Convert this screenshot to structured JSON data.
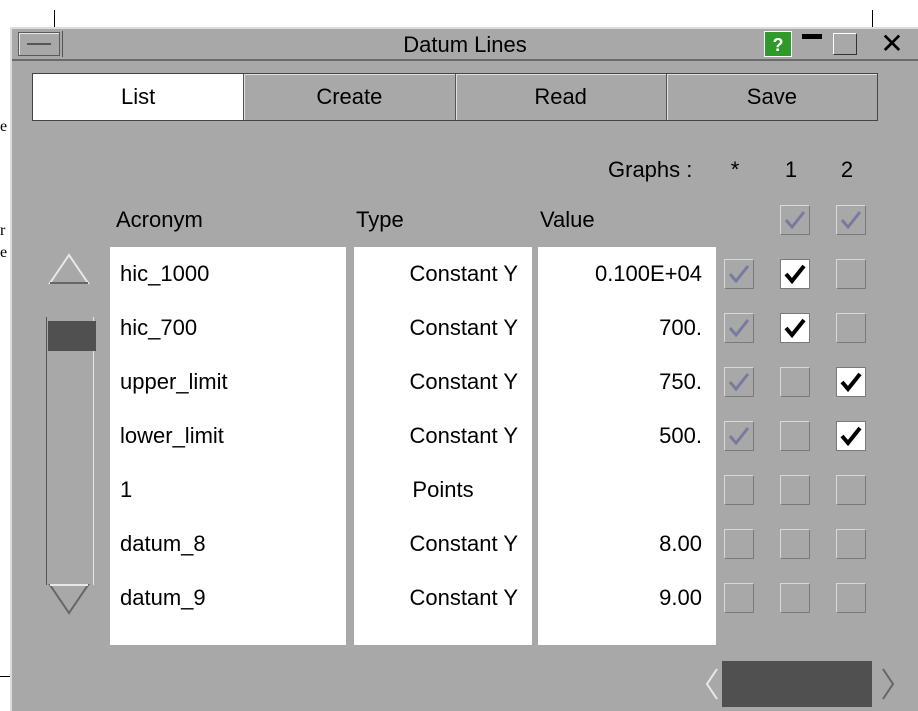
{
  "window": {
    "title": "Datum Lines",
    "help_label": "?",
    "close_label": "✕"
  },
  "tabs": [
    {
      "label": "List",
      "active": true
    },
    {
      "label": "Create",
      "active": false
    },
    {
      "label": "Read",
      "active": false
    },
    {
      "label": "Save",
      "active": false
    }
  ],
  "graphs": {
    "label": "Graphs :",
    "columns": [
      "*",
      "1",
      "2"
    ],
    "header_checks": [
      null,
      true,
      true
    ]
  },
  "columns": {
    "acronym": "Acronym",
    "type": "Type",
    "value": "Value"
  },
  "rows": [
    {
      "acronym": "hic_1000",
      "type": "Constant Y",
      "value": "0.100E+04",
      "checks": [
        "grey",
        "on",
        "off"
      ]
    },
    {
      "acronym": "hic_700",
      "type": "Constant Y",
      "value": "700.",
      "checks": [
        "grey",
        "on",
        "off"
      ]
    },
    {
      "acronym": "upper_limit",
      "type": "Constant Y",
      "value": "750.",
      "checks": [
        "grey",
        "off",
        "on"
      ]
    },
    {
      "acronym": "lower_limit",
      "type": "Constant Y",
      "value": "500.",
      "checks": [
        "grey",
        "off",
        "on"
      ]
    },
    {
      "acronym": "1",
      "type": "Points",
      "value": "",
      "checks": [
        "off",
        "off",
        "off"
      ]
    },
    {
      "acronym": "datum_8",
      "type": "Constant Y",
      "value": "8.00",
      "checks": [
        "off",
        "off",
        "off"
      ]
    },
    {
      "acronym": "datum_9",
      "type": "Constant Y",
      "value": "9.00",
      "checks": [
        "off",
        "off",
        "off"
      ]
    }
  ],
  "background_text": [
    "e",
    "r",
    "e"
  ],
  "colors": {
    "panel": "#a8a8a8",
    "help": "#2f9a2a",
    "thumb": "#505050",
    "grey_check": "#7a7aa0"
  }
}
